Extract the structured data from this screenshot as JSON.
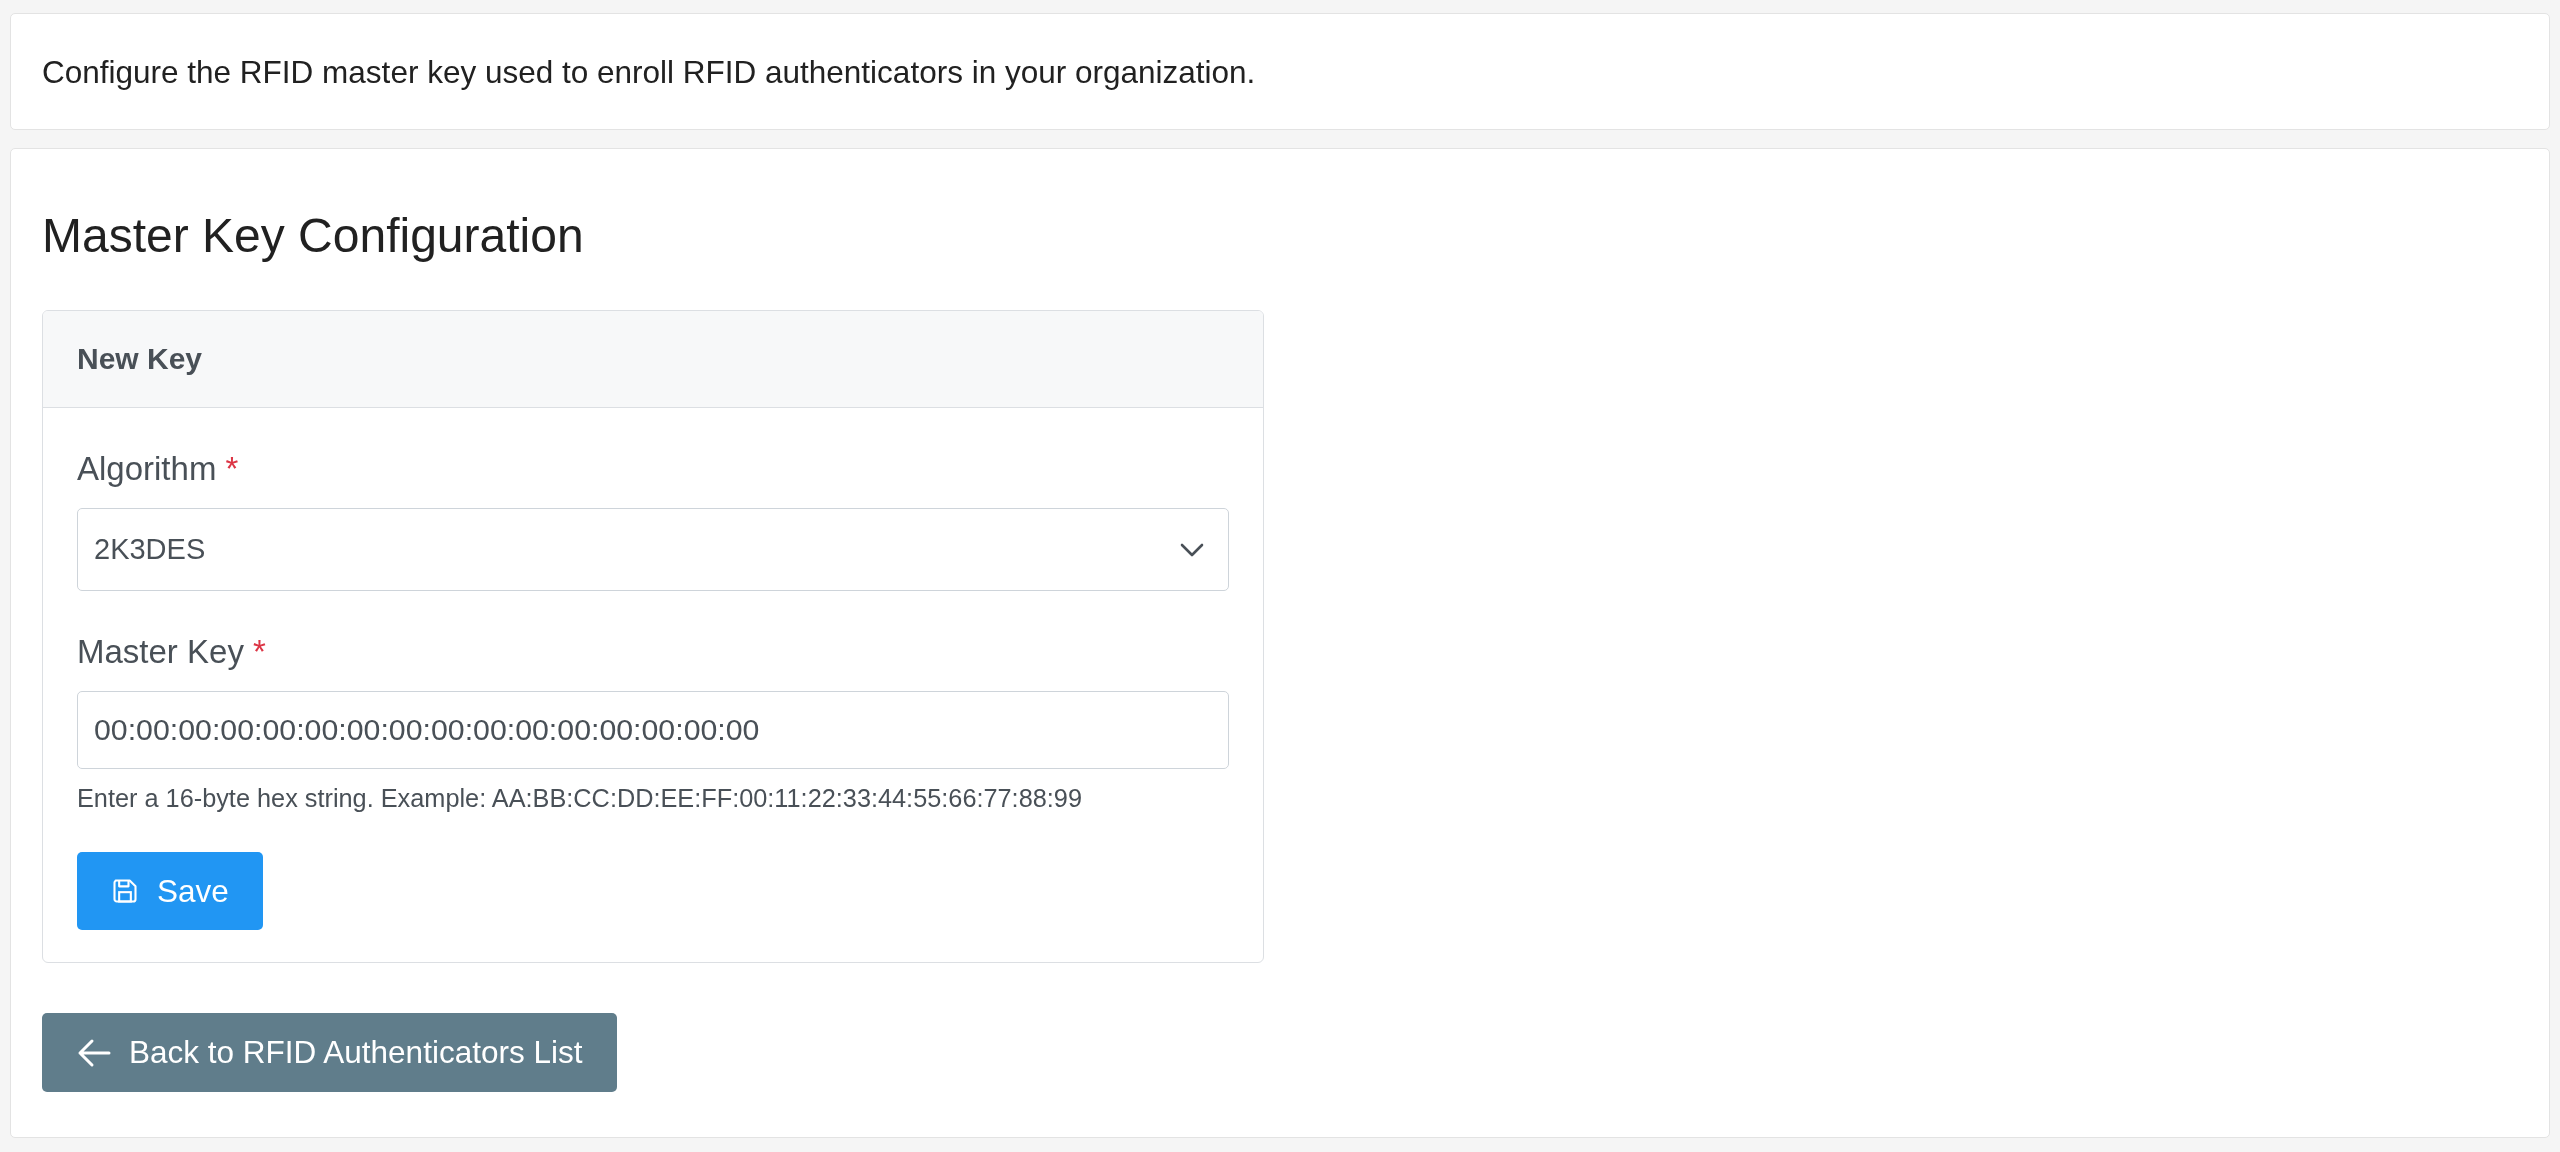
{
  "description": "Configure the RFID master key used to enroll RFID authenticators in your organization.",
  "page_title": "Master Key Configuration",
  "panel": {
    "title": "New Key",
    "fields": [
      {
        "kind": "select",
        "label": "Algorithm",
        "required_mark": "*",
        "value": "2K3DES"
      },
      {
        "kind": "text",
        "label": "Master Key",
        "required_mark": "*",
        "value": "00:00:00:00:00:00:00:00:00:00:00:00:00:00:00:00",
        "help": "Enter a 16-byte hex string. Example: AA:BB:CC:DD:EE:FF:00:11:22:33:44:55:66:77:88:99"
      }
    ],
    "save_button": {
      "label": "Save"
    }
  },
  "back_button": {
    "label": "Back to RFID Authenticators List"
  }
}
